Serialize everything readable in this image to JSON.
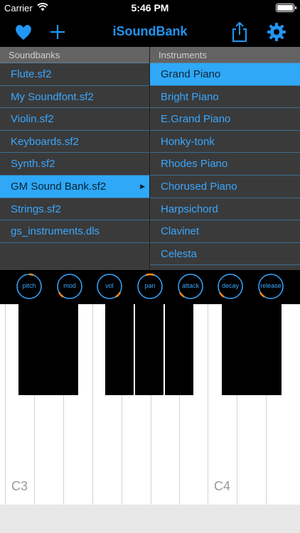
{
  "status_bar": {
    "carrier": "Carrier",
    "time": "5:46 PM"
  },
  "nav": {
    "title": "iSoundBank"
  },
  "soundbanks": {
    "header": "Soundbanks",
    "items": [
      "Flute.sf2",
      "My Soundfont.sf2",
      "Violin.sf2",
      "Keyboards.sf2",
      "Synth.sf2",
      "GM Sound Bank.sf2",
      "Strings.sf2",
      "gs_instruments.dls"
    ],
    "selected_index": 5
  },
  "instruments": {
    "header": "Instruments",
    "items": [
      "Grand Piano",
      "Bright Piano",
      "E.Grand Piano",
      "Honky-tonk",
      "Rhodes Piano",
      "Chorused Piano",
      "Harpsichord",
      "Clavinet",
      "Celesta"
    ],
    "selected_index": 0
  },
  "knobs": [
    "pitch",
    "mod",
    "vol",
    "pan",
    "attack",
    "decay",
    "release"
  ],
  "keyboard": {
    "labels": [
      "C3",
      "C4"
    ]
  },
  "colors": {
    "accent": "#2196f3",
    "selection": "#2ea8f7",
    "knob_ring": "#3aa7ff",
    "knob_indicator": "#f28c1e"
  }
}
